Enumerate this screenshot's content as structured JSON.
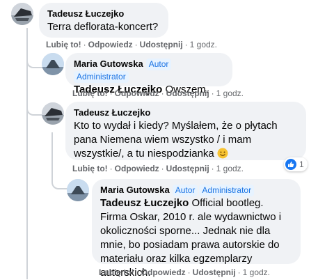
{
  "comments": [
    {
      "author": "Tadeusz Łuczejko",
      "badges": [],
      "text": "Terra deflorata-koncert?",
      "actions": {
        "like": "Lubię to!",
        "reply": "Odpowiedz",
        "share": "Udostępnij",
        "time": "1 godz."
      }
    },
    {
      "author": "Maria Gutowska",
      "badges": [
        "Autor",
        "Administrator"
      ],
      "mention": "Tadeusz Łuczejko",
      "text": "Owszem.",
      "actions": {
        "like": "Lubię to!",
        "reply": "Odpowiedz",
        "share": "Udostępnij",
        "time": "1 godz."
      }
    },
    {
      "author": "Tadeusz Łuczejko",
      "badges": [],
      "text": "Kto to wydał i kiedy? Myślałem, że o płytach pana Niemena wiem wszystko / i mam wszystkie/, a tu niespodzianka",
      "emoji": "smiling-face-emoji",
      "reaction": {
        "type": "like",
        "count": "1"
      },
      "actions": {
        "like": "Lubię to!",
        "reply": "Odpowiedz",
        "share": "Udostępnij",
        "time": "1 godz."
      }
    },
    {
      "author": "Maria Gutowska",
      "badges": [
        "Autor",
        "Administrator"
      ],
      "mention": "Tadeusz Łuczejko",
      "text": "Official bootleg. Firma Oskar, 2010 r. ale wydawnictwo i okoliczności sporne... Jednak nie dla mnie, bo posiadam prawa autorskie do materiału oraz kilka egzemplarzy autorskich.",
      "actions": {
        "like": "Lubię to!",
        "reply": "Odpowiedz",
        "share": "Udostępnij",
        "time": "1 godz."
      }
    }
  ],
  "separator": "·",
  "colors": {
    "bubble": "#f0f2f5",
    "badge_text": "#1b74e4",
    "badge_bg": "#e7f3ff",
    "meta": "#65676b",
    "like_blue": "#1877f2"
  }
}
